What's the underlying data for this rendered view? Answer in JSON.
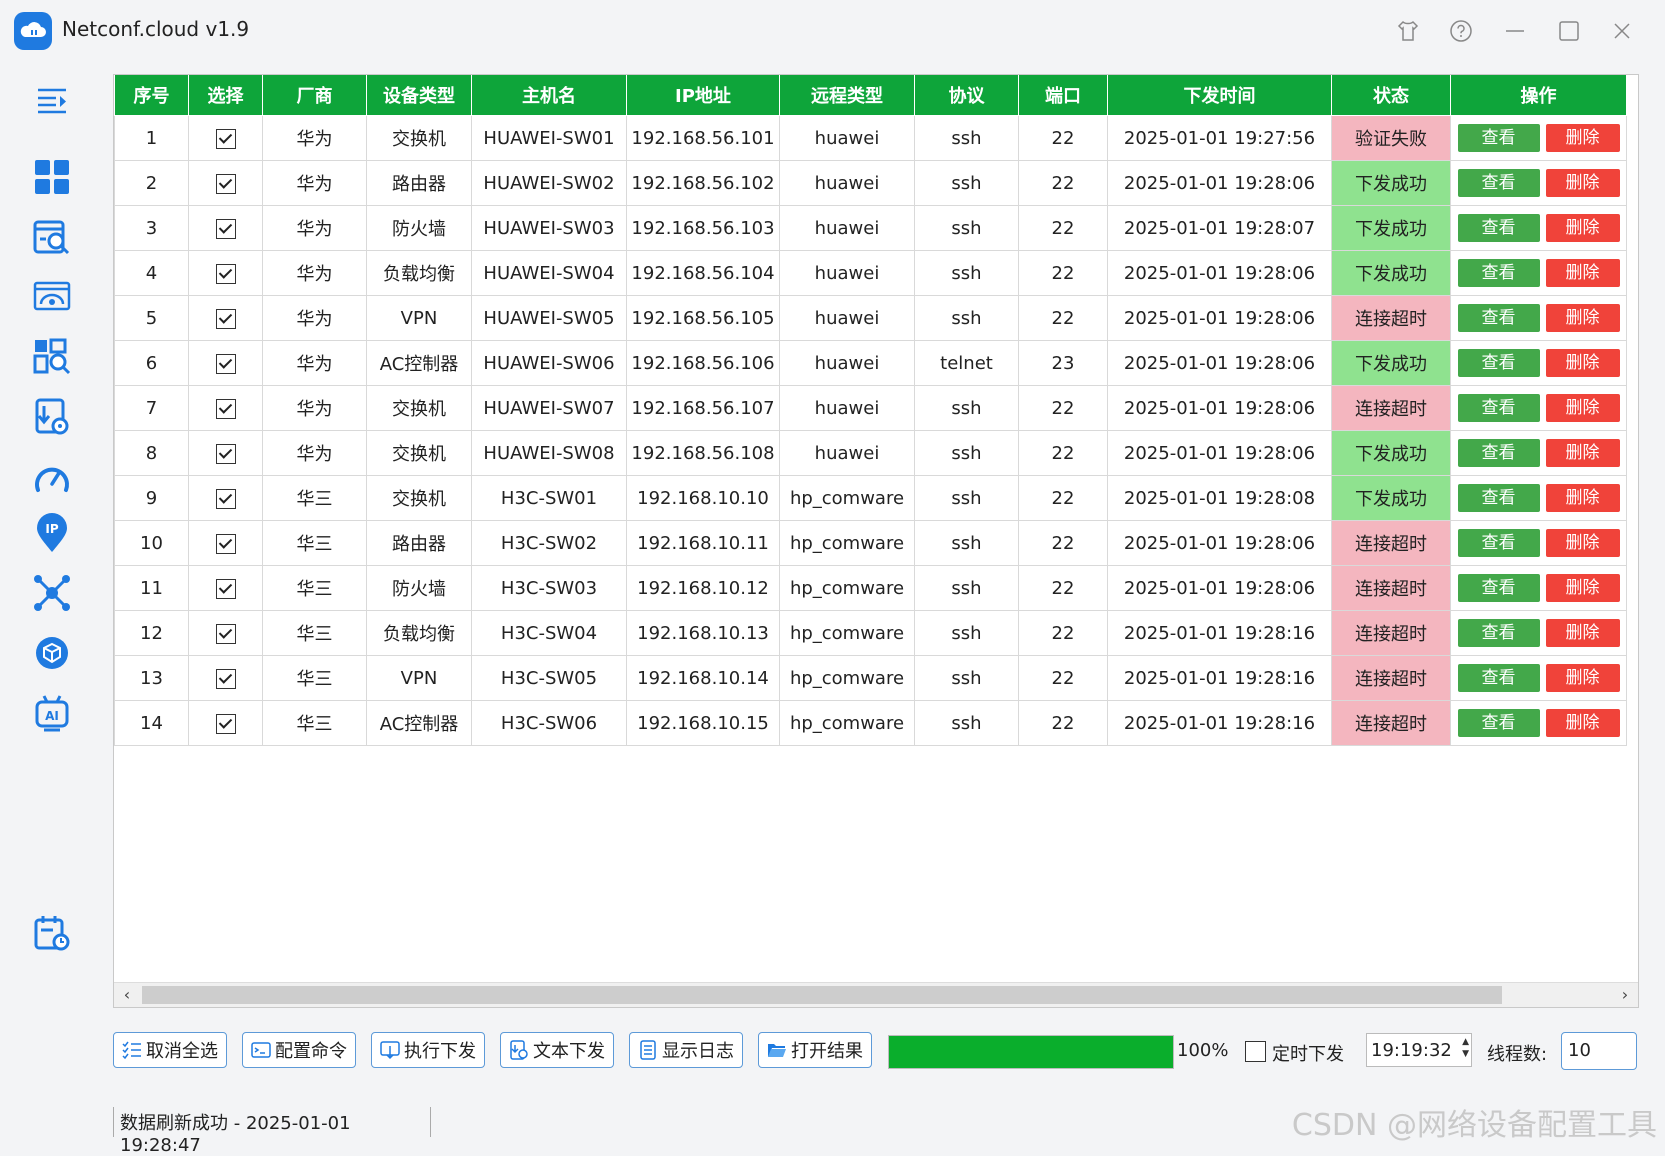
{
  "app": {
    "title": "Netconf.cloud v1.9"
  },
  "table": {
    "columns": [
      "序号",
      "选择",
      "厂商",
      "设备类型",
      "主机名",
      "IP地址",
      "远程类型",
      "协议",
      "端口",
      "下发时间",
      "状态",
      "操作"
    ],
    "view_label": "查看",
    "delete_label": "删除",
    "rows": [
      {
        "no": "1",
        "vendor": "华为",
        "type": "交换机",
        "host": "HUAWEI-SW01",
        "ip": "192.168.56.101",
        "remote": "huawei",
        "proto": "ssh",
        "port": "22",
        "time": "2025-01-01 19:27:56",
        "status": "验证失败",
        "ok": false
      },
      {
        "no": "2",
        "vendor": "华为",
        "type": "路由器",
        "host": "HUAWEI-SW02",
        "ip": "192.168.56.102",
        "remote": "huawei",
        "proto": "ssh",
        "port": "22",
        "time": "2025-01-01 19:28:06",
        "status": "下发成功",
        "ok": true
      },
      {
        "no": "3",
        "vendor": "华为",
        "type": "防火墙",
        "host": "HUAWEI-SW03",
        "ip": "192.168.56.103",
        "remote": "huawei",
        "proto": "ssh",
        "port": "22",
        "time": "2025-01-01 19:28:07",
        "status": "下发成功",
        "ok": true
      },
      {
        "no": "4",
        "vendor": "华为",
        "type": "负载均衡",
        "host": "HUAWEI-SW04",
        "ip": "192.168.56.104",
        "remote": "huawei",
        "proto": "ssh",
        "port": "22",
        "time": "2025-01-01 19:28:06",
        "status": "下发成功",
        "ok": true
      },
      {
        "no": "5",
        "vendor": "华为",
        "type": "VPN",
        "host": "HUAWEI-SW05",
        "ip": "192.168.56.105",
        "remote": "huawei",
        "proto": "ssh",
        "port": "22",
        "time": "2025-01-01 19:28:06",
        "status": "连接超时",
        "ok": false
      },
      {
        "no": "6",
        "vendor": "华为",
        "type": "AC控制器",
        "host": "HUAWEI-SW06",
        "ip": "192.168.56.106",
        "remote": "huawei",
        "proto": "telnet",
        "port": "23",
        "time": "2025-01-01 19:28:06",
        "status": "下发成功",
        "ok": true
      },
      {
        "no": "7",
        "vendor": "华为",
        "type": "交换机",
        "host": "HUAWEI-SW07",
        "ip": "192.168.56.107",
        "remote": "huawei",
        "proto": "ssh",
        "port": "22",
        "time": "2025-01-01 19:28:06",
        "status": "连接超时",
        "ok": false
      },
      {
        "no": "8",
        "vendor": "华为",
        "type": "交换机",
        "host": "HUAWEI-SW08",
        "ip": "192.168.56.108",
        "remote": "huawei",
        "proto": "ssh",
        "port": "22",
        "time": "2025-01-01 19:28:06",
        "status": "下发成功",
        "ok": true
      },
      {
        "no": "9",
        "vendor": "华三",
        "type": "交换机",
        "host": "H3C-SW01",
        "ip": "192.168.10.10",
        "remote": "hp_comware",
        "proto": "ssh",
        "port": "22",
        "time": "2025-01-01 19:28:08",
        "status": "下发成功",
        "ok": true
      },
      {
        "no": "10",
        "vendor": "华三",
        "type": "路由器",
        "host": "H3C-SW02",
        "ip": "192.168.10.11",
        "remote": "hp_comware",
        "proto": "ssh",
        "port": "22",
        "time": "2025-01-01 19:28:06",
        "status": "连接超时",
        "ok": false
      },
      {
        "no": "11",
        "vendor": "华三",
        "type": "防火墙",
        "host": "H3C-SW03",
        "ip": "192.168.10.12",
        "remote": "hp_comware",
        "proto": "ssh",
        "port": "22",
        "time": "2025-01-01 19:28:06",
        "status": "连接超时",
        "ok": false
      },
      {
        "no": "12",
        "vendor": "华三",
        "type": "负载均衡",
        "host": "H3C-SW04",
        "ip": "192.168.10.13",
        "remote": "hp_comware",
        "proto": "ssh",
        "port": "22",
        "time": "2025-01-01 19:28:16",
        "status": "连接超时",
        "ok": false
      },
      {
        "no": "13",
        "vendor": "华三",
        "type": "VPN",
        "host": "H3C-SW05",
        "ip": "192.168.10.14",
        "remote": "hp_comware",
        "proto": "ssh",
        "port": "22",
        "time": "2025-01-01 19:28:16",
        "status": "连接超时",
        "ok": false
      },
      {
        "no": "14",
        "vendor": "华三",
        "type": "AC控制器",
        "host": "H3C-SW06",
        "ip": "192.168.10.15",
        "remote": "hp_comware",
        "proto": "ssh",
        "port": "22",
        "time": "2025-01-01 19:28:16",
        "status": "连接超时",
        "ok": false
      }
    ]
  },
  "toolbar": {
    "deselect_all": "取消全选",
    "config_cmd": "配置命令",
    "execute": "执行下发",
    "text_push": "文本下发",
    "show_log": "显示日志",
    "open_result": "打开结果",
    "progress_percent": 100,
    "progress_label": "100%",
    "timer_label": "定时下发",
    "time_value": "19:19:32",
    "threads_label": "线程数:",
    "threads_value": "10"
  },
  "status_bar": {
    "message": "数据刷新成功 - 2025-01-01 19:28:47"
  },
  "watermark": "CSDN @网络设备配置工具",
  "colors": {
    "accent": "#1f7ae0",
    "header_green": "#0ea53a",
    "ok_bg": "#8fe28f",
    "fail_bg": "#f4b6bf",
    "view_btn": "#43a84a",
    "delete_btn": "#f0433a"
  },
  "sidebar_icons": [
    "menu-collapse-icon",
    "dashboard-icon",
    "search-doc-icon",
    "gateway-icon",
    "query-icon",
    "download-config-icon",
    "speed-gauge-icon",
    "ip-location-icon",
    "topology-icon",
    "cube-icon",
    "ai-robot-icon",
    "calendar-clock-icon"
  ]
}
